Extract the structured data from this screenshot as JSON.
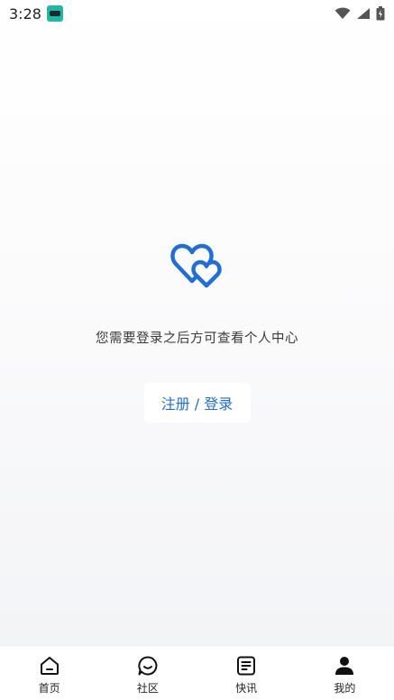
{
  "status_bar": {
    "time": "3:28"
  },
  "main": {
    "message": "您需要登录之后方可查看个人中心",
    "login_button": "注册 / 登录",
    "accent_color": "#1f6fd6"
  },
  "tabs": [
    {
      "label": "首页",
      "icon": "home-icon"
    },
    {
      "label": "社区",
      "icon": "chat-bubble-icon"
    },
    {
      "label": "快讯",
      "icon": "news-list-icon"
    },
    {
      "label": "我的",
      "icon": "person-icon",
      "active": true
    }
  ]
}
